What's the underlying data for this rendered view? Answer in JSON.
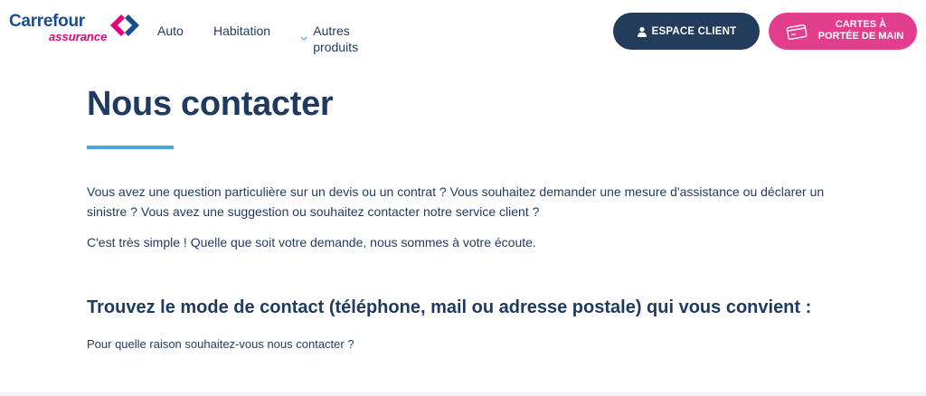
{
  "logo": {
    "brand": "Carrefour",
    "sub": "assurance",
    "brand_color": "#1b4d8e",
    "accent_color": "#e3007c"
  },
  "nav": {
    "items": [
      {
        "label": "Auto"
      },
      {
        "label": "Habitation"
      },
      {
        "label": "Autres produits",
        "icon": "chevron-down-icon"
      }
    ]
  },
  "actions": {
    "espace_client": {
      "label": "ESPACE CLIENT",
      "icon": "user-icon",
      "color": "#233c5c"
    },
    "cartes": {
      "label": "CARTES À\nPORTÉE DE MAIN",
      "icon": "card-icon",
      "color": "#e33d8d"
    }
  },
  "main": {
    "title": "Nous contacter",
    "underline_color": "#4aa8e0",
    "intro": "Vous avez une question particulière sur un devis ou un contrat ? Vous souhaitez demander une mesure d'assistance ou déclarer un sinistre ? Vous avez une suggestion ou souhaitez contacter notre service client ?",
    "simple": "C'est très simple ! Quelle que soit votre demande, nous sommes à votre écoute.",
    "subtitle": "Trouvez le mode de contact (téléphone, mail ou adresse postale) qui vous convient :",
    "question": "Pour quelle raison souhaitez-vous nous contacter ?"
  }
}
